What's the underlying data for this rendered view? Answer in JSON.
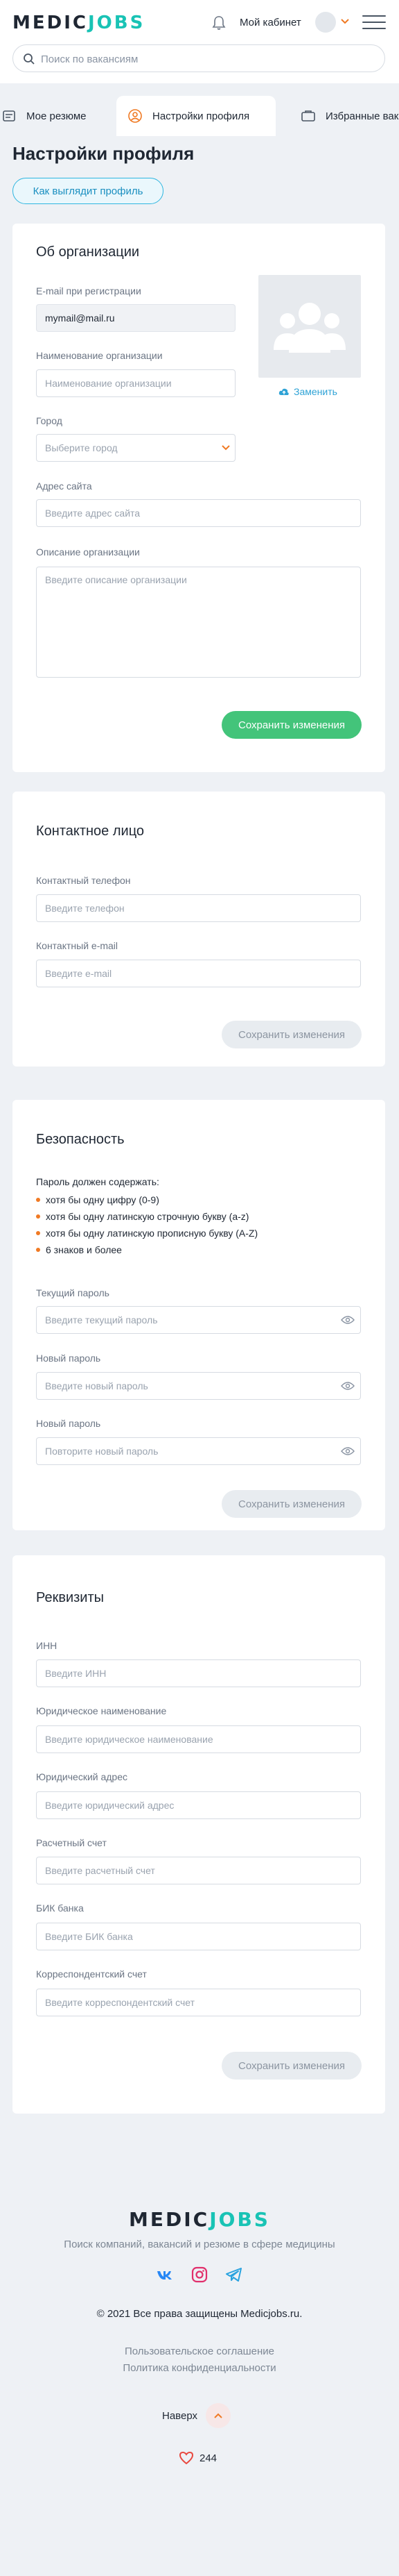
{
  "header": {
    "logo_medic": "MEDIC",
    "logo_jobs": "JOBS",
    "cabinet_label": "Мой кабинет",
    "search_placeholder": "Поиск по вакансиям"
  },
  "tabs": [
    {
      "label": "Мое резюме",
      "icon": "resume-icon",
      "active": false
    },
    {
      "label": "Настройки профиля",
      "icon": "profile-settings-icon",
      "active": true
    },
    {
      "label": "Избранные вакансии",
      "icon": "favorites-icon",
      "active": false
    }
  ],
  "page_title": "Настройки профиля",
  "preview_button": "Как выглядит профиль",
  "organization": {
    "title": "Об организации",
    "email_label": "E-mail при регистрации",
    "email_value": "mymail@mail.ru",
    "name_label": "Наименование организации",
    "name_placeholder": "Наименование организации",
    "city_label": "Город",
    "city_placeholder": "Выберите город",
    "site_label": "Адрес сайта",
    "site_placeholder": "Введите адрес сайта",
    "description_label": "Описание организации",
    "description_placeholder": "Введите описание организации",
    "change_photo": "Заменить",
    "save_button": "Сохранить изменения"
  },
  "contact": {
    "title": "Контактное лицо",
    "phone_label": "Контактный телефон",
    "phone_placeholder": "Введите телефон",
    "email_label": "Контактный e-mail",
    "email_placeholder": "Введите e-mail",
    "save_button": "Сохранить изменения"
  },
  "security": {
    "title": "Безопасность",
    "rules_title": "Пароль должен содержать:",
    "rules": [
      "хотя бы одну цифру (0-9)",
      "хотя бы одну латинскую строчную букву (a-z)",
      "хотя бы одну латинскую прописную букву (A-Z)",
      "6 знаков и более"
    ],
    "current_label": "Текущий пароль",
    "current_placeholder": "Введите текущий пароль",
    "new_label": "Новый пароль",
    "new_placeholder": "Введите новый пароль",
    "repeat_label": "Новый пароль",
    "repeat_placeholder": "Повторите новый пароль",
    "save_button": "Сохранить изменения"
  },
  "requisites": {
    "title": "Реквизиты",
    "inn_label": "ИНН",
    "inn_placeholder": "Введите ИНН",
    "legal_name_label": "Юридическое наименование",
    "legal_name_placeholder": "Введите юридическое наименование",
    "legal_address_label": "Юридический адрес",
    "legal_address_placeholder": "Введите юридический адрес",
    "account_label": "Расчетный счет",
    "account_placeholder": "Введите расчетный счет",
    "bik_label": "БИК банка",
    "bik_placeholder": "Введите БИК банка",
    "corr_label": "Корреспондентский счет",
    "corr_placeholder": "Введите корреспондентский счет",
    "save_button": "Сохранить изменения"
  },
  "footer": {
    "logo_medic": "MEDIC",
    "logo_jobs": "JOBS",
    "tagline": "Поиск компаний, вакансий и резюме в сфере медицины",
    "copyright": "© 2021 Все права защищены Medicjobs.ru.",
    "agreement": "Пользовательское соглашение",
    "privacy": "Политика конфиденциальности",
    "to_top": "Наверх",
    "likes": "244"
  },
  "colors": {
    "accent_teal": "#19c3b5",
    "save_green": "#43c47a",
    "link_blue": "#2fa3d6",
    "bullet_orange": "#f07a24"
  }
}
